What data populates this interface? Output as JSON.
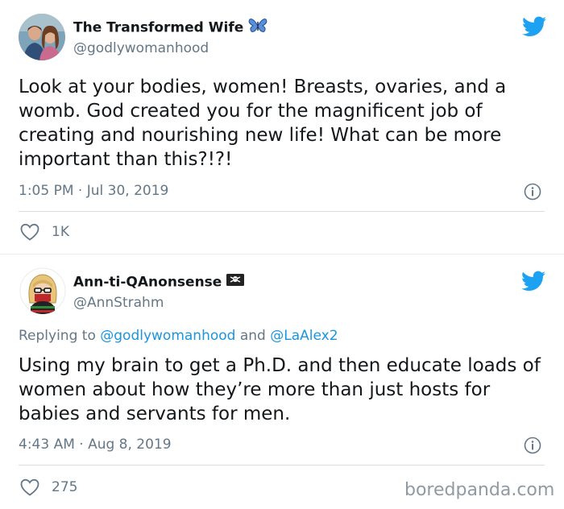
{
  "tweets": [
    {
      "author_name": "The Transformed Wife",
      "name_emoji": "butterfly-emoji",
      "handle": "@godlywomanhood",
      "text": "Look at your bodies, women! Breasts, ovaries, and a womb. God created you for the magnificent job of creating and nourishing new life! What can be more important than this?!?!",
      "timestamp": "1:05 PM · Jul 30, 2019",
      "likes": "1K"
    },
    {
      "author_name": "Ann-ti-QAnonsense",
      "name_emoji": "pirate-flag-emoji",
      "handle": "@AnnStrahm",
      "reply_prefix": "Replying to",
      "reply_user1": "@godlywomanhood",
      "reply_and": "and",
      "reply_user2": "@LaAlex2",
      "text": "Using my brain to get a Ph.D. and then educate loads of women about how they’re more than just hosts for babies and servants for men.",
      "timestamp": "4:43 AM · Aug 8, 2019",
      "likes": "275"
    }
  ],
  "watermark": "boredpanda.com",
  "colors": {
    "twitter_blue": "#1da1f2",
    "link_blue": "#1b95e0",
    "secondary_text": "#657786"
  }
}
